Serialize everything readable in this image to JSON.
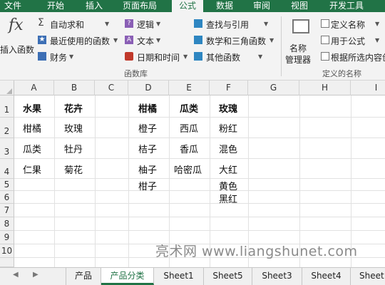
{
  "ribbon_tabs": [
    "文件",
    "开始",
    "插入",
    "页面布局",
    "公式",
    "数据",
    "审阅",
    "视图",
    "开发工具"
  ],
  "ribbon": {
    "insert_function": {
      "glyph": "fx",
      "label": "插入函数"
    },
    "autosum": "自动求和",
    "recent": "最近使用的函数",
    "finance": "财务",
    "logic": "逻辑",
    "text": "文本",
    "datetime": "日期和时间",
    "lookup": "查找与引用",
    "math": "数学和三角函数",
    "other": "其他函数",
    "group_library": "函数库",
    "name_manager": [
      "名称",
      "管理器"
    ],
    "define_name": "定义名称",
    "use_in_formula": "用于公式",
    "create_from_selection": "根据所选内容创",
    "group_names": "定义的名称"
  },
  "columns": [
    "A",
    "B",
    "C",
    "D",
    "E",
    "F",
    "G",
    "H",
    "I"
  ],
  "rows": [
    "1",
    "2",
    "3",
    "4",
    "5",
    "6",
    "7",
    "8",
    "9",
    "10"
  ],
  "cells": {
    "A1": "水果",
    "B1": "花卉",
    "D1": "柑橘",
    "E1": "瓜类",
    "F1": "玫瑰",
    "A2": "柑橘",
    "B2": "玫瑰",
    "D2": "橙子",
    "E2": "西瓜",
    "F2": "粉红",
    "A3": "瓜类",
    "B3": "牡丹",
    "D3": "桔子",
    "E3": "香瓜",
    "F3": "混色",
    "A4": "仁果",
    "B4": "菊花",
    "D4": "柚子",
    "E4": "哈密瓜",
    "F4": "大红",
    "D5": "柑子",
    "F5": "黄色",
    "F6": "黑红"
  },
  "sheet_tabs": [
    "产品",
    "产品分类",
    "Sheet1",
    "Sheet5",
    "Sheet3",
    "Sheet4",
    "Sheet"
  ],
  "active_sheet": "产品分类",
  "watermark": "亮术网 www.liangshunet.com"
}
